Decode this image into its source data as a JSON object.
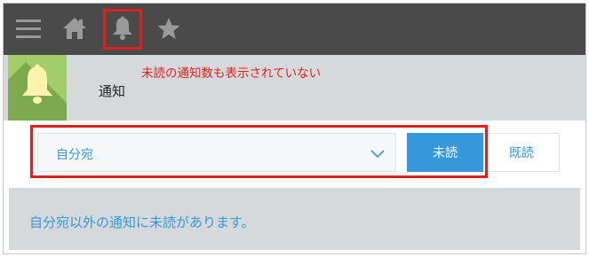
{
  "topbar": {
    "icons": [
      "menu-icon",
      "home-icon",
      "bell-icon",
      "star-icon"
    ],
    "bg_color": "#4a4a4a",
    "highlight_color": "#e0201c"
  },
  "header": {
    "title": "通知",
    "icon": "bell-icon",
    "icon_bg_color": "#a3cd6b"
  },
  "annotation": {
    "text": "未読の通知数も表示されていない",
    "color": "#e0201c"
  },
  "filter": {
    "dropdown_value": "自分宛",
    "unread_label": "未読",
    "read_label": "既読",
    "active": "unread",
    "accent_color": "#3498db"
  },
  "message": {
    "text": "自分宛以外の通知に未読があります。"
  }
}
